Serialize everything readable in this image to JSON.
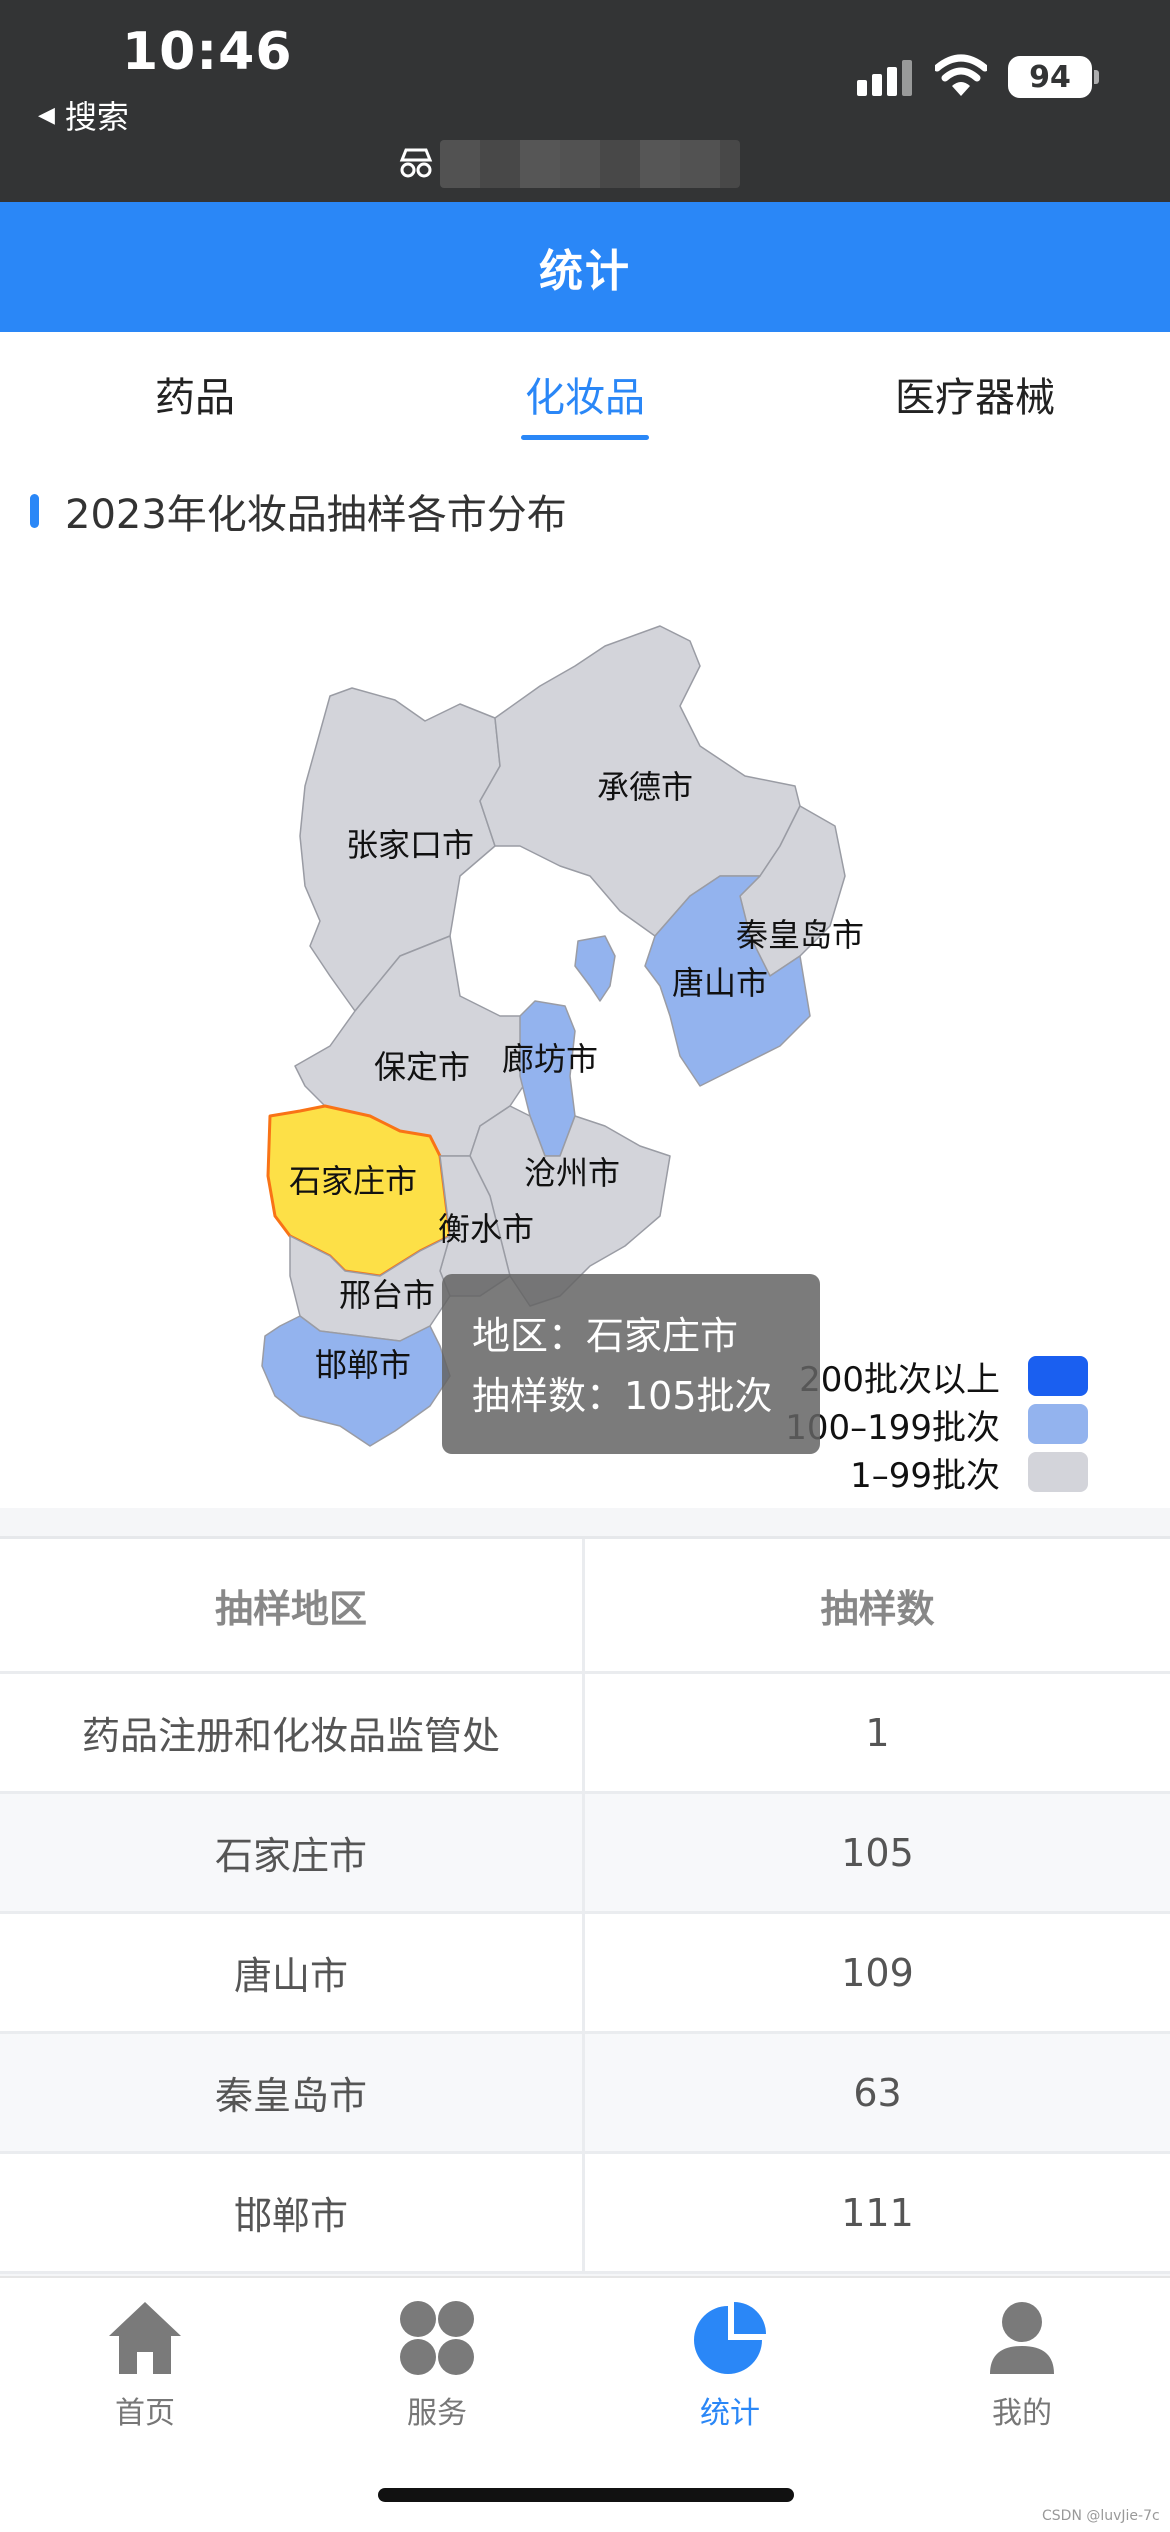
{
  "status_bar": {
    "time": "10:46",
    "back_label": "搜索",
    "battery": "94"
  },
  "header": {
    "title": "统计"
  },
  "tabs": [
    {
      "label": "药品",
      "active": false
    },
    {
      "label": "化妆品",
      "active": true
    },
    {
      "label": "医疗器械",
      "active": false
    }
  ],
  "chart_title": "2023年化妆品抽样各市分布",
  "regions": [
    {
      "name": "张家口市",
      "level": "1-99"
    },
    {
      "name": "承德市",
      "level": "1-99"
    },
    {
      "name": "秦皇岛市",
      "level": "1-99"
    },
    {
      "name": "唐山市",
      "level": "100-199"
    },
    {
      "name": "保定市",
      "level": "1-99"
    },
    {
      "name": "廊坊市",
      "level": "100-199"
    },
    {
      "name": "沧州市",
      "level": "1-99"
    },
    {
      "name": "石家庄市",
      "level": "100-199",
      "highlighted": true
    },
    {
      "name": "衡水市",
      "level": "1-99"
    },
    {
      "name": "邢台市",
      "level": "1-99"
    },
    {
      "name": "邯郸市",
      "level": "100-199"
    }
  ],
  "tooltip": {
    "line1": "地区：石家庄市",
    "line2": "抽样数：105批次"
  },
  "legend": [
    {
      "label": "200批次以上",
      "color": "#1a5ff0"
    },
    {
      "label": "100–199批次",
      "color": "#93b3ee"
    },
    {
      "label": "1–99批次",
      "color": "#d3d4da"
    }
  ],
  "colors": {
    "accent": "#2a87f7",
    "highlight": "#fde047",
    "highlight_border": "#f97316"
  },
  "table": {
    "headers": [
      "抽样地区",
      "抽样数"
    ],
    "rows": [
      [
        "药品注册和化妆品监管处",
        "1"
      ],
      [
        "石家庄市",
        "105"
      ],
      [
        "唐山市",
        "109"
      ],
      [
        "秦皇岛市",
        "63"
      ],
      [
        "邯郸市",
        "111"
      ]
    ]
  },
  "nav": [
    {
      "label": "首页",
      "icon": "home-icon",
      "active": false
    },
    {
      "label": "服务",
      "icon": "grid-icon",
      "active": false
    },
    {
      "label": "统计",
      "icon": "pie-chart-icon",
      "active": true
    },
    {
      "label": "我的",
      "icon": "user-icon",
      "active": false
    }
  ],
  "watermark": "CSDN @luvJie-7c"
}
